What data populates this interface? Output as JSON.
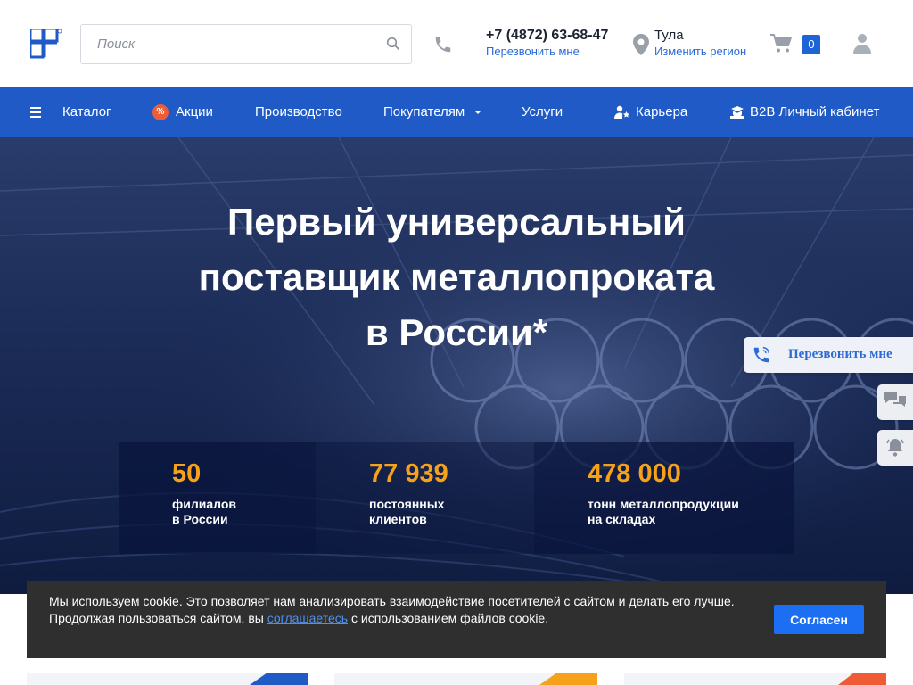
{
  "header": {
    "logo_icon": "company-logo",
    "search_placeholder": "Поиск",
    "phone": "+7 (4872) 63-68-47",
    "callback_link": "Перезвонить мне",
    "city": "Тула",
    "change_region": "Изменить регион",
    "cart_count": "0"
  },
  "nav": {
    "items": [
      {
        "label": "Каталог",
        "icon": "hamburger-icon"
      },
      {
        "label": "Акции",
        "icon": "percent-badge-icon"
      },
      {
        "label": "Производство"
      },
      {
        "label": "Покупателям",
        "icon": "caret-down-icon"
      },
      {
        "label": "Услуги"
      },
      {
        "label": "Карьера",
        "icon": "person-star-icon"
      },
      {
        "label": "B2B Личный кабинет",
        "icon": "cabinet-icon"
      }
    ],
    "promo_symbol": "%"
  },
  "hero": {
    "title_line1": "Первый универсальный",
    "title_line2": "поставщик металлопроката",
    "title_line3": "в России*",
    "stats": [
      {
        "value": "50",
        "line1": "филиалов",
        "line2": "в России"
      },
      {
        "value": "77 939",
        "line1": "постоянных",
        "line2": "клиентов"
      },
      {
        "value": "478 000",
        "line1": "тонн металлопродукции",
        "line2": "на складах"
      }
    ]
  },
  "widgets": {
    "callback_label": "Перезвонить мне"
  },
  "cookie": {
    "text_part1": "Мы используем cookie. Это позволяет нам анализировать взаимодействие посетителей с сайтом и делать его лучше.",
    "text_part2": "Продолжая пользоваться сайтом, вы",
    "link_text": "соглашаетесь",
    "text_part3": "с использованием файлов cookie.",
    "button": "Согласен"
  },
  "colors": {
    "nav_bg": "#1f5ac7",
    "accent_orange": "#f5a21a",
    "link_blue": "#2a6ad8",
    "cookie_button": "#1c6ef2"
  }
}
